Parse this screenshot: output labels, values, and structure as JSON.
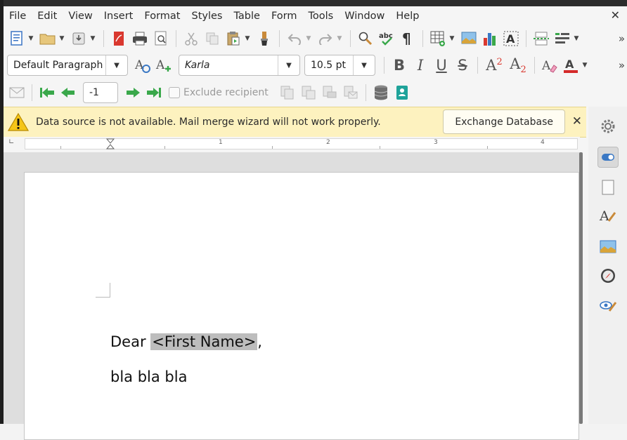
{
  "menu": [
    "File",
    "Edit",
    "View",
    "Insert",
    "Format",
    "Styles",
    "Table",
    "Form",
    "Tools",
    "Window",
    "Help"
  ],
  "window_close": "✕",
  "toolbar1_overflow": "»",
  "toolbar2_overflow": "»",
  "formatting": {
    "paragraph_style": "Default Paragraph",
    "font_name": "Karla",
    "font_size": "10.5 pt",
    "bold": "B",
    "italic": "I",
    "underline": "U",
    "strike": "S",
    "superscript": "A²",
    "subscript": "A₂"
  },
  "mailmerge": {
    "record_value": "-1",
    "exclude_recipient": "Exclude recipient"
  },
  "infobar": {
    "message": "Data source is not available. Mail merge wizard will not work properly.",
    "button": "Exchange Database",
    "close": "✕"
  },
  "ruler_labels": [
    "1",
    "2",
    "3",
    "4"
  ],
  "document": {
    "line1_prefix": "Dear ",
    "line1_field": "<First Name>",
    "line1_suffix": ",",
    "line2": "bla bla bla"
  },
  "colors": {
    "accent_green": "#3aa84b",
    "infobar_bg": "#fdf2bf",
    "font_color_red": "#d42a2a",
    "field_shading": "#bdbdbd"
  }
}
